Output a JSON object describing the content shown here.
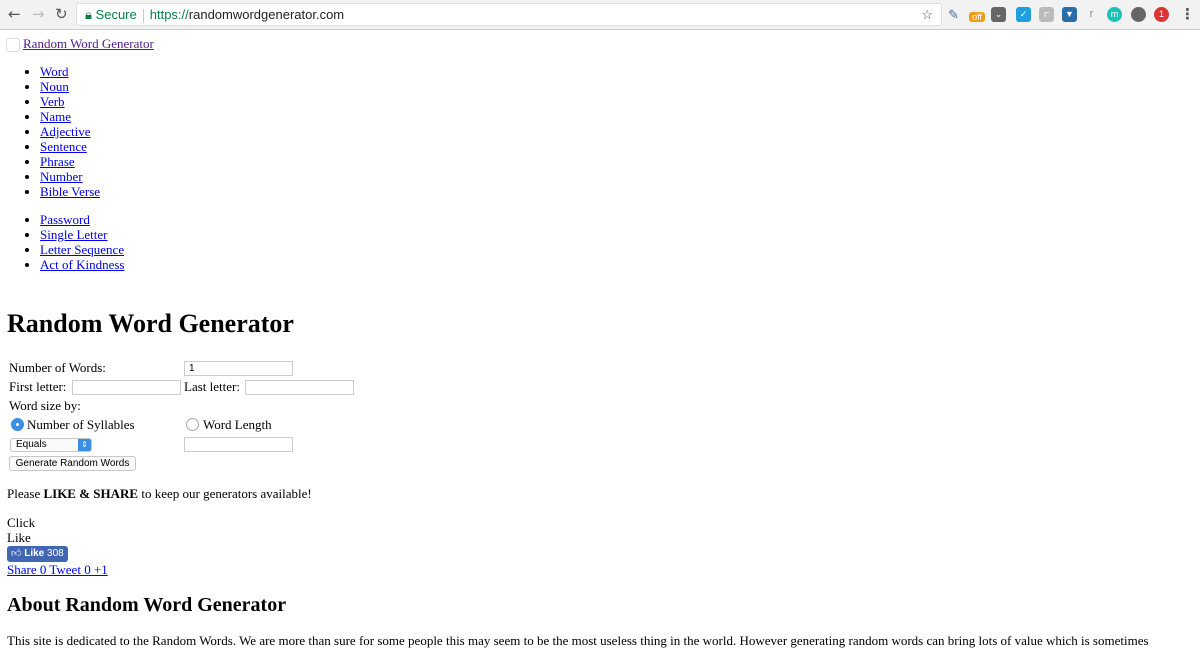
{
  "browser": {
    "secure_label": "Secure",
    "url_scheme": "https://",
    "url_host": "randomwordgenerator.com",
    "ext_off_label": "off",
    "ext_r_label": "r",
    "ext_m_label": "m",
    "ext_badge": "1"
  },
  "logo_link": "Random Word Generator",
  "nav_primary": [
    "Word",
    "Noun",
    "Verb",
    "Name",
    "Adjective",
    "Sentence",
    "Phrase",
    "Number",
    "Bible Verse"
  ],
  "nav_secondary": [
    "Password",
    "Single Letter",
    "Letter Sequence",
    "Act of Kindness"
  ],
  "page_title": "Random Word Generator",
  "form": {
    "num_words_label": "Number of Words:",
    "num_words_value": "1",
    "first_letter_label": "First letter:",
    "first_letter_value": "",
    "last_letter_label": "Last letter:",
    "last_letter_value": "",
    "word_size_label": "Word size by:",
    "radio_syllables": "Number of Syllables",
    "radio_length": "Word Length",
    "selected": "Number of Syllables",
    "select_value": "Equals",
    "length_value": "",
    "generate_label": "Generate Random Words"
  },
  "share": {
    "pre": "Please ",
    "bold": "LIKE & SHARE",
    "post": " to keep our generators available!",
    "click": "Click",
    "like": "Like",
    "fb_like": "Like",
    "fb_count": "308",
    "links": "Share 0 Tweet 0 +1"
  },
  "about": {
    "title": "About Random Word Generator",
    "text": "This site is dedicated to the Random Words. We are more than sure for some people this may seem to be the most useless thing in the world. However generating random words can bring lots of value which is sometimes"
  }
}
